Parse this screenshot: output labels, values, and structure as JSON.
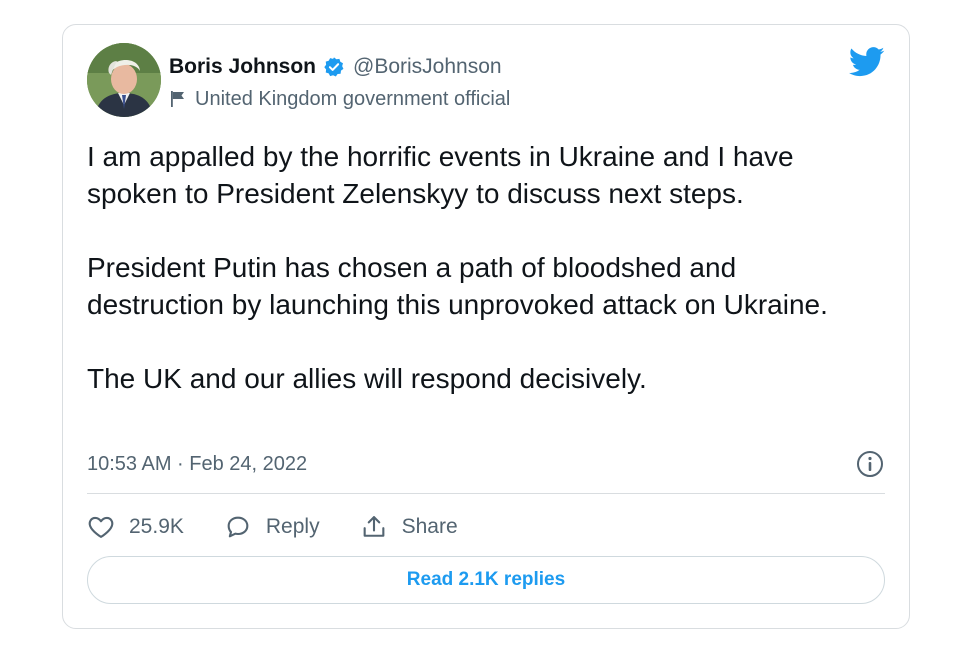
{
  "author": {
    "name": "Boris Johnson",
    "handle": "@BorisJohnson",
    "label": "United Kingdom government official",
    "verified": true,
    "avatar_icon": "profile-photo"
  },
  "tweet": {
    "paragraphs": [
      "I am appalled by the horrific events in Ukraine and I have spoken to President Zelenskyy to discuss next steps.",
      "President Putin has chosen a path of bloodshed and destruction by launching this unprovoked attack on Ukraine.",
      "The UK and our allies will respond decisively."
    ],
    "timestamp": "10:53 AM · Feb 24, 2022"
  },
  "actions": {
    "like_count": "25.9K",
    "reply_label": "Reply",
    "share_label": "Share"
  },
  "read_replies_label": "Read 2.1K replies",
  "icons": {
    "brand": "twitter-bird-icon",
    "verified": "verified-badge-icon",
    "label": "flag-icon",
    "info": "info-icon",
    "like": "heart-icon",
    "reply": "speech-bubble-icon",
    "share": "share-icon"
  },
  "colors": {
    "brand_blue": "#1d9bf0",
    "text_primary": "#0f1419",
    "text_secondary": "#536471",
    "border": "#d9dde0"
  }
}
